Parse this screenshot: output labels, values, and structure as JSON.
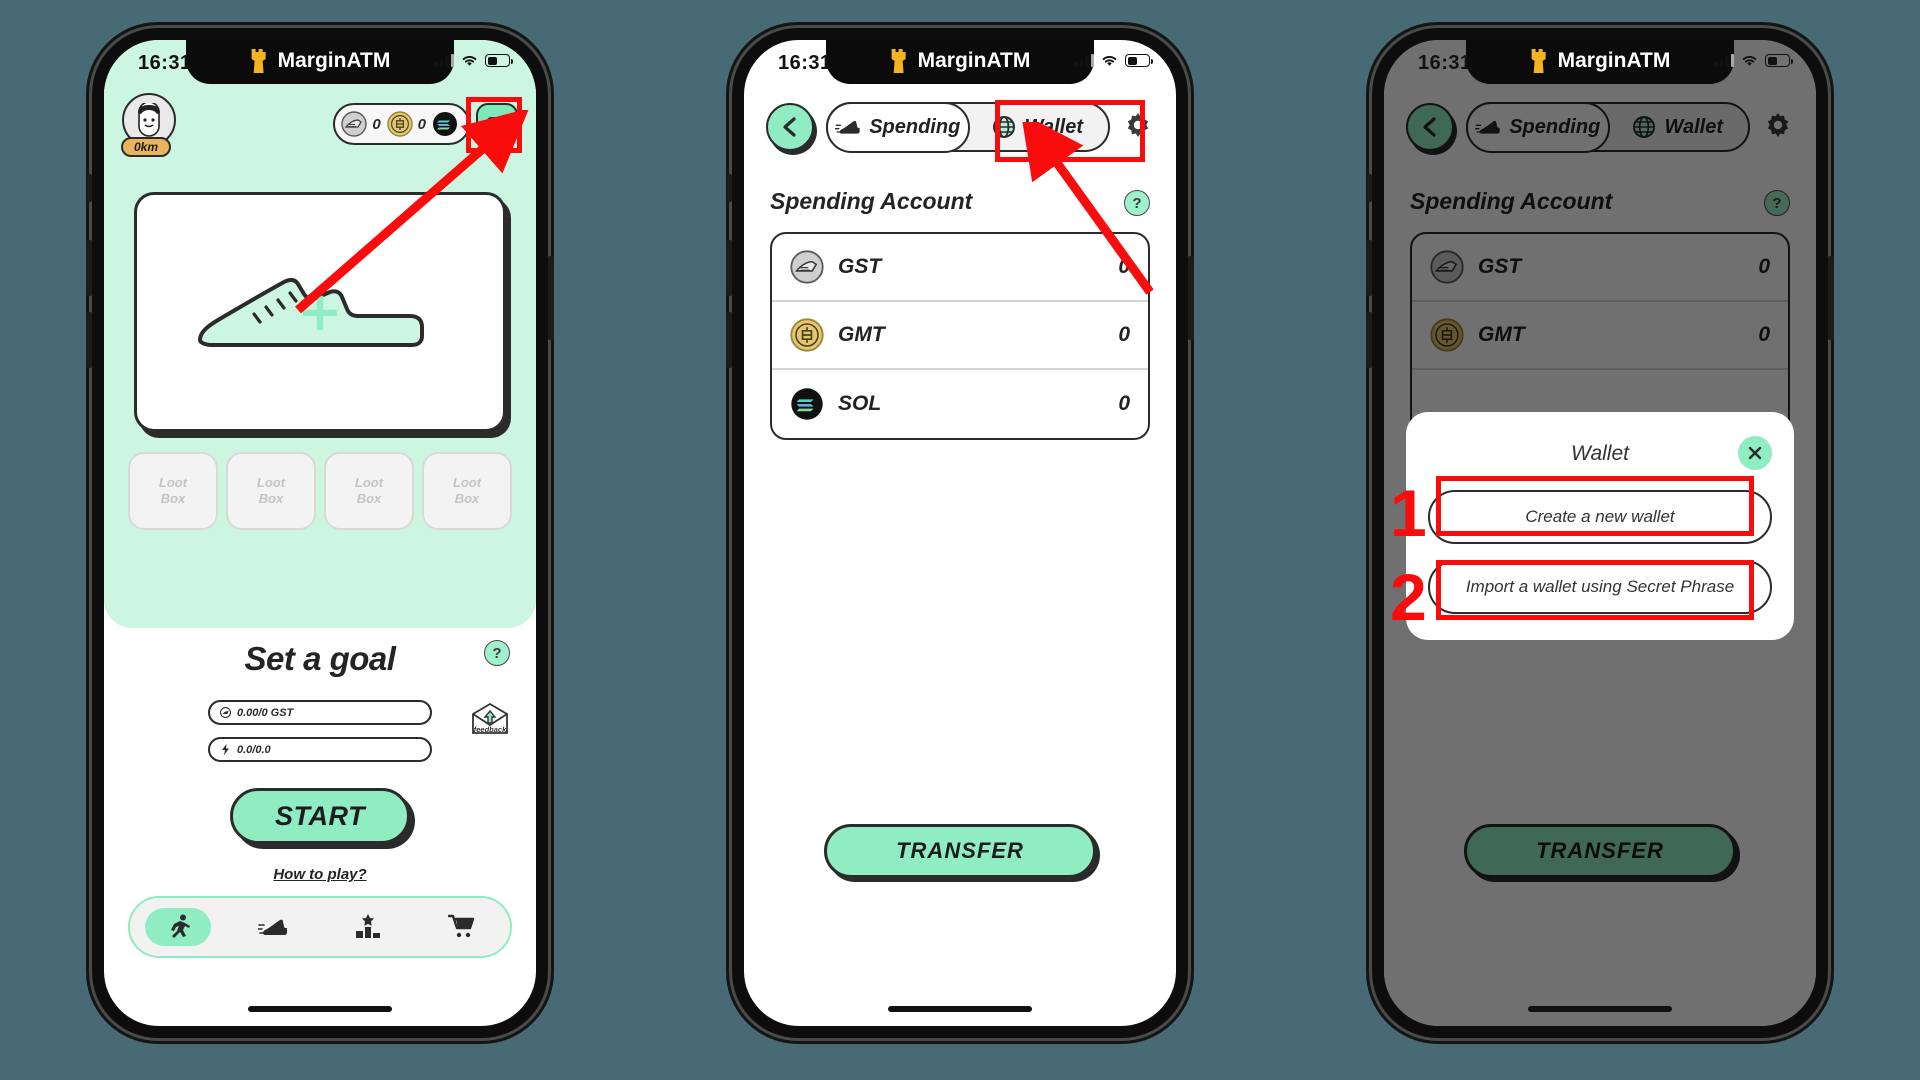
{
  "app": {
    "brand": "MarginATM",
    "status_time": "16:31"
  },
  "phone1": {
    "name": "home-screen",
    "profile": {
      "km_badge": "0km"
    },
    "coin_pill": [
      {
        "icon": "gst-coin-icon",
        "value": "0"
      },
      {
        "icon": "gmt-coin-icon",
        "value": "0"
      },
      {
        "icon": "sol-coin-icon",
        "value": ""
      }
    ],
    "wallet_button_icon": "wallet-swap-icon",
    "shoe_card": {
      "icon": "sneaker-outline-icon",
      "plus": "+"
    },
    "loot_boxes": [
      {
        "line1": "Loot",
        "line2": "Box"
      },
      {
        "line1": "Loot",
        "line2": "Box"
      },
      {
        "line1": "Loot",
        "line2": "Box"
      },
      {
        "line1": "Loot",
        "line2": "Box"
      }
    ],
    "goal": {
      "title": "Set a goal",
      "help": "?",
      "feedback_label": "feedback",
      "field_gst": "0.00/0 GST",
      "field_energy": "0.0/0.0",
      "start_label": "START",
      "how_to_play": "How to play?"
    },
    "tabbar": [
      {
        "icon": "runner-icon",
        "active": true
      },
      {
        "icon": "sneaker-icon",
        "active": false
      },
      {
        "icon": "podium-star-icon",
        "active": false
      },
      {
        "icon": "shopping-cart-icon",
        "active": false
      }
    ]
  },
  "phone2": {
    "name": "spending-account-screen",
    "back_icon": "chevron-left-icon",
    "tabs": [
      {
        "label": "Spending",
        "icon": "sneaker-icon",
        "active": true
      },
      {
        "label": "Wallet",
        "icon": "globe-icon",
        "active": false
      }
    ],
    "settings_icon": "gear-icon",
    "section_title": "Spending Account",
    "section_help": "?",
    "accounts": [
      {
        "icon": "gst-coin-icon",
        "name": "GST",
        "value": "0"
      },
      {
        "icon": "gmt-coin-icon",
        "name": "GMT",
        "value": "0"
      },
      {
        "icon": "sol-coin-icon",
        "name": "SOL",
        "value": "0"
      }
    ],
    "transfer_label": "TRANSFER"
  },
  "phone3": {
    "name": "wallet-modal-screen",
    "back_icon": "chevron-left-icon",
    "tabs": [
      {
        "label": "Spending",
        "icon": "sneaker-icon",
        "active": true
      },
      {
        "label": "Wallet",
        "icon": "globe-icon",
        "active": false
      }
    ],
    "settings_icon": "gear-icon",
    "section_title": "Spending Account",
    "section_help": "?",
    "accounts": [
      {
        "icon": "gst-coin-icon",
        "name": "GST",
        "value": "0"
      },
      {
        "icon": "gmt-coin-icon",
        "name": "GMT",
        "value": "0"
      }
    ],
    "transfer_label": "TRANSFER",
    "modal": {
      "title": "Wallet",
      "close_icon": "close-icon",
      "options": [
        {
          "step": "1",
          "label": "Create a new wallet"
        },
        {
          "step": "2",
          "label": "Import a wallet using Secret Phrase"
        }
      ]
    }
  },
  "colors": {
    "mint": "#8fecc3",
    "mint_light": "#ccf6e2",
    "annotation_red": "#f90c0c",
    "gold": "#e0c36a",
    "ink": "#2b2b2b",
    "page_bg": "#476a75"
  }
}
